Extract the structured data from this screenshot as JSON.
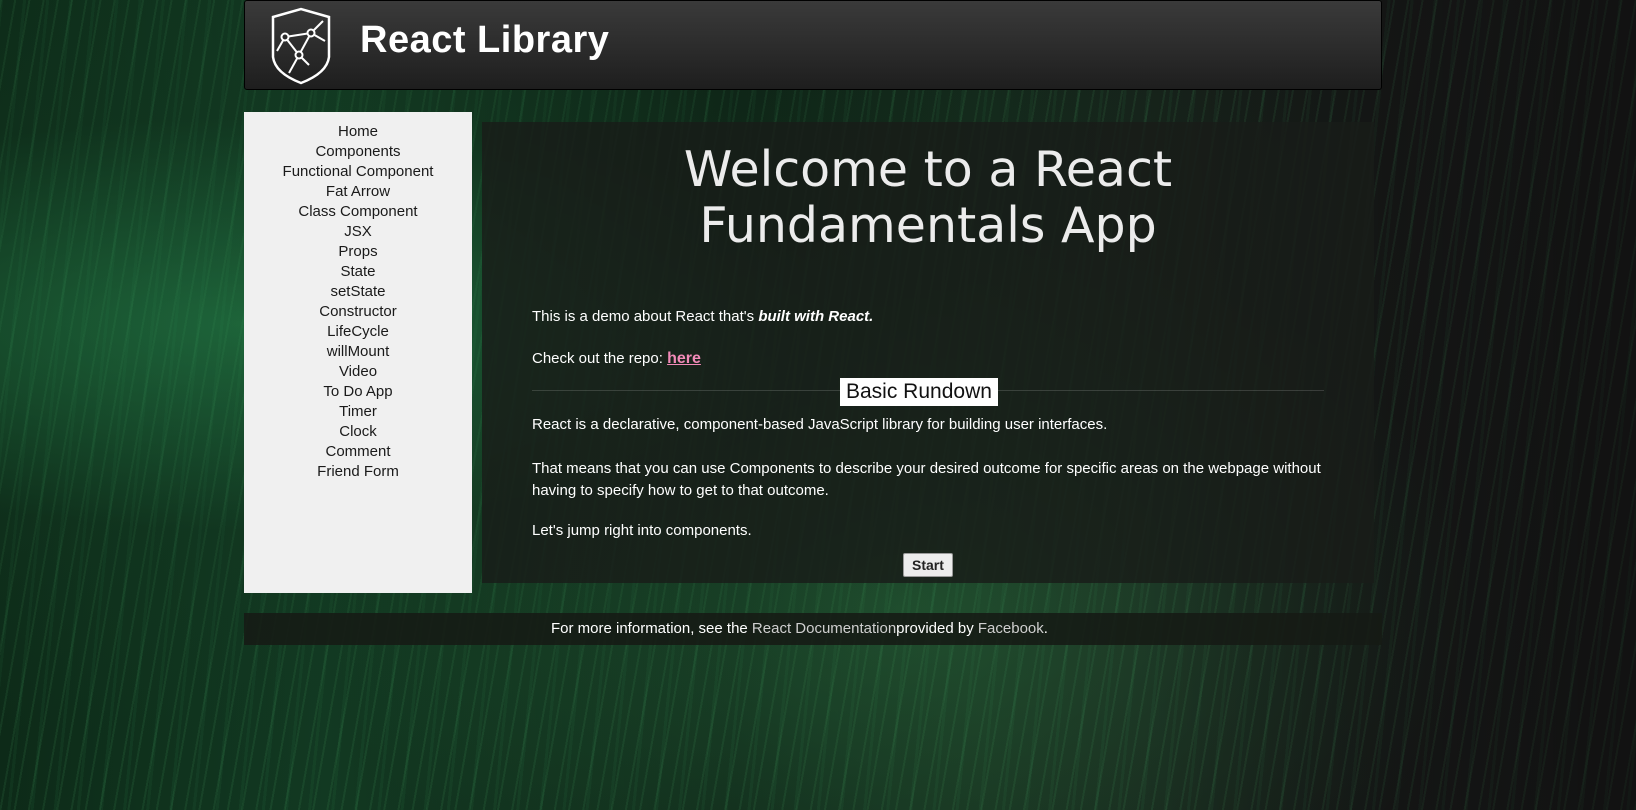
{
  "header": {
    "title": "React Library",
    "logo_icon": "react-library-shield-logo"
  },
  "sidebar": {
    "items": [
      "Home",
      "Components",
      "Functional Component",
      "Fat Arrow",
      "Class Component",
      "JSX",
      "Props",
      "State",
      "setState",
      "Constructor",
      "LifeCycle",
      "willMount",
      "Video",
      "To Do App",
      "Timer",
      "Clock",
      "Comment",
      "Friend Form"
    ]
  },
  "main": {
    "welcome": "Welcome to a React Fundamentals App",
    "intro_prefix": "This is a demo about React that's ",
    "intro_emphasis": "built with React.",
    "repo_prefix": "Check out the repo: ",
    "repo_link": "here",
    "rundown_heading": "Basic Rundown",
    "paragraph1": "React is a declarative, component-based JavaScript library for building user interfaces.",
    "paragraph2": "That means that you can use Components to describe your desired outcome for specific areas on the webpage without having to specify how to get to that outcome.",
    "paragraph3": "Let's jump right into components.",
    "start_label": "Start"
  },
  "footer": {
    "prefix": "For more information, see the ",
    "docs_link": "React Documentation",
    "middle": "provided by ",
    "facebook_link": "Facebook",
    "suffix": "."
  },
  "colors": {
    "repo_link": "#f28ab8",
    "sidebar_bg": "#f0f0f0",
    "header_bg": "#2b2b2b"
  }
}
